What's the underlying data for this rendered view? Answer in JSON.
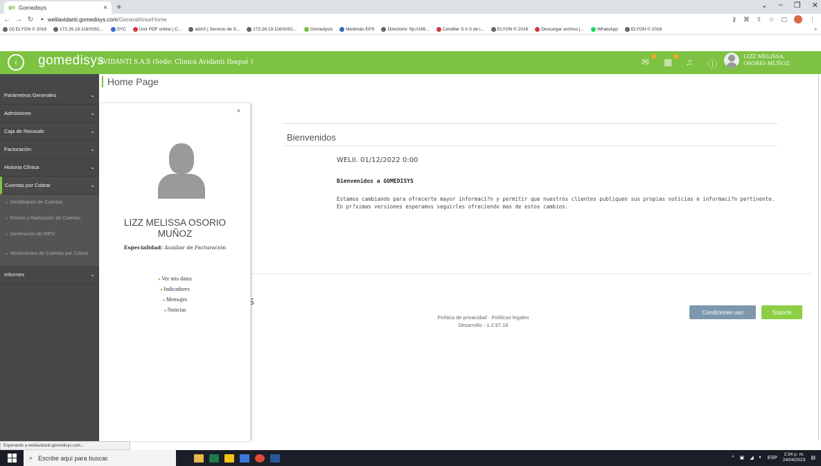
{
  "browser": {
    "tab_title": "Gomedisys",
    "tab_close": "×",
    "new_tab": "+",
    "url_domain": "weliiavidanti.gomedisys.com",
    "url_path": "/GeneralArea/Home",
    "bookmarks": [
      "(3) ELYON © 2016",
      "172.26.19.116/SISC...",
      "SYC",
      "Unir PDF online | C...",
      "adAS | Servicio de S...",
      "172.26.19.116/SISC...",
      "Gomedysis",
      "Medimás EPS",
      "Directorio: ftp://186...",
      "Cenditer S A S de l...",
      "ELYON © 2016",
      "Descargar archivo |...",
      "WhatsApp",
      "ELYON © 2016"
    ],
    "bookmarks_more": "»",
    "status_text": "Esperando a weliiavidanti.gomedisys.com..."
  },
  "header": {
    "logo": "gomedisys",
    "company": "AVIDANTI S.A.S (Sede: Clinica Avidanti Ibagué )",
    "user_first": "LIZZ MELISSA,",
    "user_last": "OSORIO MUÑOZ",
    "accent_color": "#7dc242"
  },
  "sidebar": {
    "items": [
      {
        "label": "Parámetros Generales"
      },
      {
        "label": "Admisiones"
      },
      {
        "label": "Caja de Recaudo"
      },
      {
        "label": "Facturación"
      },
      {
        "label": "Historia Clínica"
      },
      {
        "label": "Cuentas por Cobrar"
      }
    ],
    "sub_items": [
      "Desbloqueo de Cuentas",
      "Envíos y Radicación de Cuentas",
      "Generación de RIPS",
      "Movimientos de Cuentas por Cobrar"
    ],
    "last_item": "Informes"
  },
  "main": {
    "page_title": "Home Page",
    "welcome": "Bienvenidos",
    "news_date": "WELII. 01/12/2022 0:00",
    "news_title": "Bienvenidos a GOMEDISYS",
    "news_line1": "Estamos cambiando para ofrecerte mayor informaci?n y permitir que nuestros clientes publiquen sus propias noticias e informaci?n pertinente.",
    "news_line2": "En pr?ximas versiones esperamos seguirles ofreciendo mas de estos cambios.",
    "partial_text": "S",
    "footer_links": "Política de privacidad · Políticas legales",
    "version": "Desarrollo - 1.2.97.18",
    "btn_conditions": "Condiciones uso",
    "btn_support": "Soporte"
  },
  "profile_panel": {
    "close": "×",
    "name_line1": "LIZZ MELISSA OSORIO",
    "name_line2": "MUÑOZ",
    "specialty_label": "Especialidad:",
    "specialty_value": "Auxiliar de Facturación",
    "links": [
      "Ver mis datos",
      "Indicadores",
      "Mensajes",
      "Noticias"
    ]
  },
  "taskbar": {
    "search_placeholder": "Escribe aquí para buscar.",
    "lang": "ESP",
    "time": "2:34 p. m.",
    "date": "24/04/2023"
  }
}
